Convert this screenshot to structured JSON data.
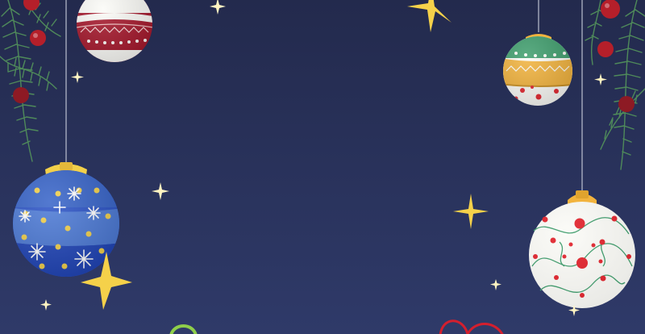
{
  "scene": {
    "kind": "christmas-banner",
    "text": "",
    "colors": {
      "background_top": "#232a4d",
      "background_bottom": "#2f3a69",
      "star": "#f5d14a",
      "sparkle": "#fff4c2",
      "branch": "#4f8a5a",
      "berry": "#b51f2a",
      "ornament_red": "#a5172b",
      "ornament_blue": "#2a52c6",
      "ornament_gold": "#f2b33d",
      "ornament_green": "#3f9e6d",
      "ornament_white": "#fbfbf7"
    },
    "ornaments": [
      {
        "name": "red-striped-ornament",
        "colors": [
          "#a5172b",
          "#fbfbf7"
        ]
      },
      {
        "name": "blue-star-ornament",
        "colors": [
          "#2a52c6",
          "#4b79d6",
          "#f2d04a"
        ]
      },
      {
        "name": "green-gold-ornament",
        "colors": [
          "#3f9e6d",
          "#f2b33d",
          "#fbfbf7"
        ]
      },
      {
        "name": "white-swirl-ornament",
        "colors": [
          "#fbfbf7",
          "#e3262f",
          "#3f9e6d"
        ]
      }
    ],
    "icons": [
      "star-icon",
      "sparkle-icon",
      "holly-berry-icon",
      "ribbon-icon"
    ]
  }
}
